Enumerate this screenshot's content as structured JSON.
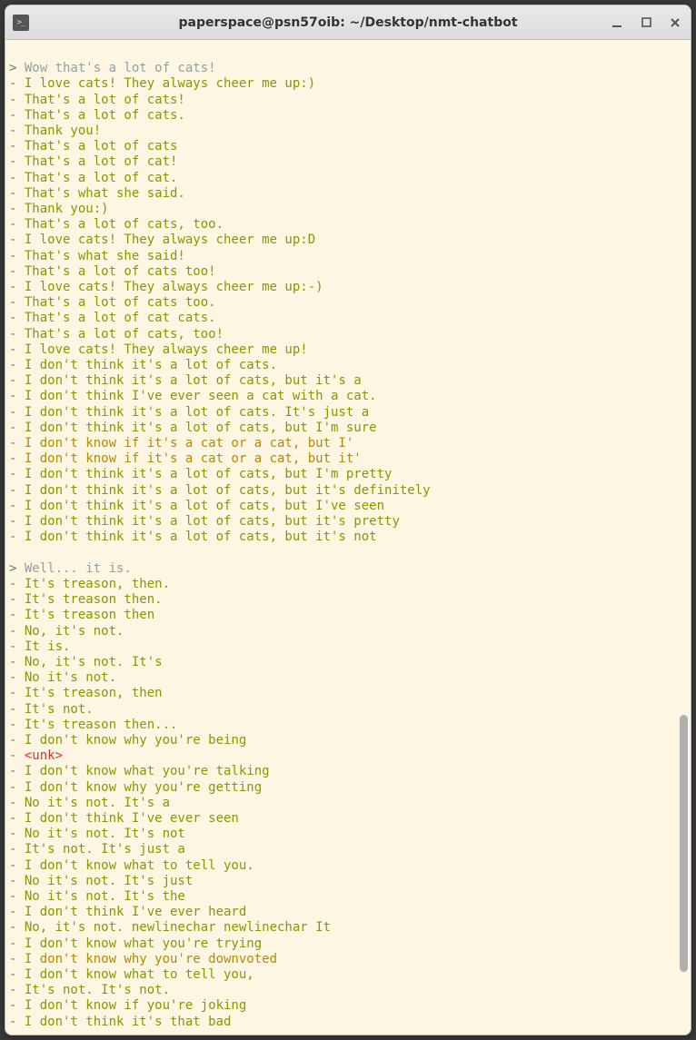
{
  "window": {
    "title": "paperspace@psn57oib: ~/Desktop/nmt-chatbot"
  },
  "conversation": [
    {
      "prompt": "Wow that's a lot of cats!",
      "responses": [
        {
          "text": "I love cats! They always cheer me up:)",
          "color": "green"
        },
        {
          "text": "That's a lot of cats!",
          "color": "green"
        },
        {
          "text": "That's a lot of cats.",
          "color": "green"
        },
        {
          "text": "Thank you!",
          "color": "green"
        },
        {
          "text": "That's a lot of cats",
          "color": "green"
        },
        {
          "text": "That's a lot of cat!",
          "color": "green"
        },
        {
          "text": "That's a lot of cat.",
          "color": "green"
        },
        {
          "text": "That's what she said.",
          "color": "green"
        },
        {
          "text": "Thank you:)",
          "color": "green"
        },
        {
          "text": "That's a lot of cats, too.",
          "color": "green"
        },
        {
          "text": "I love cats! They always cheer me up:D",
          "color": "green"
        },
        {
          "text": "That's what she said!",
          "color": "green"
        },
        {
          "text": "That's a lot of cats too!",
          "color": "green"
        },
        {
          "text": "I love cats! They always cheer me up:-)",
          "color": "green"
        },
        {
          "text": "That's a lot of cats too.",
          "color": "green"
        },
        {
          "text": "That's a lot of cat cats.",
          "color": "green"
        },
        {
          "text": "That's a lot of cats, too!",
          "color": "green"
        },
        {
          "text": "I love cats! They always cheer me up!",
          "color": "green"
        },
        {
          "text": "I don't think it's a lot of cats.",
          "color": "green"
        },
        {
          "text": "I don't think it's a lot of cats, but it's a",
          "color": "green"
        },
        {
          "text": "I don't think I've ever seen a cat with a cat.",
          "color": "green"
        },
        {
          "text": "I don't think it's a lot of cats. It's just a",
          "color": "green"
        },
        {
          "text": "I don't think it's a lot of cats, but I'm sure",
          "color": "green"
        },
        {
          "text": "I don't know if it's a cat or a cat, but I'",
          "color": "orange"
        },
        {
          "text": "I don't know if it's a cat or a cat, but it'",
          "color": "orange"
        },
        {
          "text": "I don't think it's a lot of cats, but I'm pretty",
          "color": "green"
        },
        {
          "text": "I don't think it's a lot of cats, but it's definitely",
          "color": "green"
        },
        {
          "text": "I don't think it's a lot of cats, but I've seen",
          "color": "green"
        },
        {
          "text": "I don't think it's a lot of cats, but it's pretty",
          "color": "green"
        },
        {
          "text": "I don't think it's a lot of cats, but it's not",
          "color": "green"
        }
      ]
    },
    {
      "prompt": "Well... it is.",
      "responses": [
        {
          "text": "It's treason, then.",
          "color": "green"
        },
        {
          "text": "It's treason then.",
          "color": "green"
        },
        {
          "text": "It's treason then",
          "color": "green"
        },
        {
          "text": "No, it's not.",
          "color": "green"
        },
        {
          "text": "It is.",
          "color": "green"
        },
        {
          "text": "No, it's not. It's",
          "color": "green"
        },
        {
          "text": "No it's not.",
          "color": "green"
        },
        {
          "text": "It's treason, then",
          "color": "green"
        },
        {
          "text": "It's not.",
          "color": "green"
        },
        {
          "text": "It's treason then...",
          "color": "green"
        },
        {
          "text": "I don't know why you're being",
          "color": "green"
        },
        {
          "text": "<unk>",
          "color": "red"
        },
        {
          "text": "I don't know what you're talking",
          "color": "green"
        },
        {
          "text": "I don't know why you're getting",
          "color": "green"
        },
        {
          "text": "No it's not. It's a",
          "color": "green"
        },
        {
          "text": "I don't think I've ever seen",
          "color": "green"
        },
        {
          "text": "No it's not. It's not",
          "color": "green"
        },
        {
          "text": "It's not. It's just a",
          "color": "green"
        },
        {
          "text": "I don't know what to tell you.",
          "color": "green"
        },
        {
          "text": "No it's not. It's just",
          "color": "green"
        },
        {
          "text": "No it's not. It's the",
          "color": "green"
        },
        {
          "text": "I don't think I've ever heard",
          "color": "green"
        },
        {
          "text": "No, it's not. newlinechar newlinechar It",
          "color": "green"
        },
        {
          "text": "I don't know what you're trying",
          "color": "green"
        },
        {
          "text": "I don't know why you're downvoted",
          "color": "orange"
        },
        {
          "text": "I don't know what to tell you,",
          "color": "green"
        },
        {
          "text": "It's not. It's not.",
          "color": "green"
        },
        {
          "text": "I don't know if you're joking",
          "color": "green"
        },
        {
          "text": "I don't think it's that bad",
          "color": "green"
        }
      ]
    }
  ]
}
